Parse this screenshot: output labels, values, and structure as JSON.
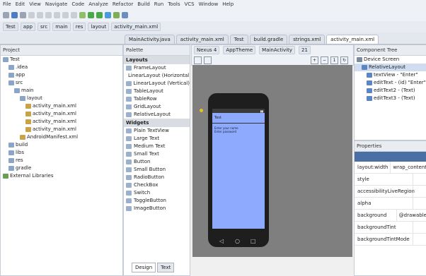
{
  "menubar": {
    "items": [
      "File",
      "Edit",
      "View",
      "Navigate",
      "Code",
      "Analyze",
      "Refactor",
      "Build",
      "Run",
      "Tools",
      "VCS",
      "Window",
      "Help"
    ]
  },
  "navbar": {
    "crumbs": [
      "Test",
      "app",
      "src",
      "main",
      "res",
      "layout",
      "activity_main.xml"
    ]
  },
  "tabs": [
    "MainActivity.java",
    "activity_main.xml",
    "Test",
    "build.gradle",
    "strings.xml",
    "activity_main.xml"
  ],
  "project": {
    "header": "Project",
    "rows": [
      {
        "label": "Test",
        "indent": 0,
        "icon": "folder-icon"
      },
      {
        "label": ".idea",
        "indent": 1,
        "icon": "folder-icon"
      },
      {
        "label": "app",
        "indent": 1,
        "icon": "folder-icon"
      },
      {
        "label": "src",
        "indent": 1,
        "icon": "folder-icon"
      },
      {
        "label": "main",
        "indent": 2,
        "icon": "folder-icon"
      },
      {
        "label": "layout",
        "indent": 3,
        "icon": "folder-icon"
      },
      {
        "label": "activity_main.xml",
        "indent": 4,
        "icon": "file-icon"
      },
      {
        "label": "activity_main.xml",
        "indent": 4,
        "icon": "file-icon"
      },
      {
        "label": "activity_main.xml",
        "indent": 4,
        "icon": "file-icon"
      },
      {
        "label": "activity_main.xml",
        "indent": 4,
        "icon": "file-icon"
      },
      {
        "label": "AndroidManifest.xml",
        "indent": 3,
        "icon": "file-icon"
      },
      {
        "label": "build",
        "indent": 1,
        "icon": "folder-icon"
      },
      {
        "label": "libs",
        "indent": 1,
        "icon": "folder-icon"
      },
      {
        "label": "res",
        "indent": 1,
        "icon": "folder-icon"
      },
      {
        "label": "gradle",
        "indent": 1,
        "icon": "folder-icon"
      },
      {
        "label": "External Libraries",
        "indent": 0,
        "icon": "library-icon"
      }
    ]
  },
  "palette": {
    "header": "Palette",
    "rows": [
      {
        "label": "Layouts",
        "type": "head"
      },
      {
        "label": "FrameLayout",
        "type": "item"
      },
      {
        "label": "LinearLayout (Horizontal)",
        "type": "item"
      },
      {
        "label": "LinearLayout (Vertical)",
        "type": "item"
      },
      {
        "label": "TableLayout",
        "type": "item"
      },
      {
        "label": "TableRow",
        "type": "item"
      },
      {
        "label": "GridLayout",
        "type": "item"
      },
      {
        "label": "RelativeLayout",
        "type": "item"
      },
      {
        "label": "Widgets",
        "type": "head"
      },
      {
        "label": "Plain TextView",
        "type": "item"
      },
      {
        "label": "Large Text",
        "type": "item"
      },
      {
        "label": "Medium Text",
        "type": "item"
      },
      {
        "label": "Small Text",
        "type": "item"
      },
      {
        "label": "Button",
        "type": "item"
      },
      {
        "label": "Small Button",
        "type": "item"
      },
      {
        "label": "RadioButton",
        "type": "item"
      },
      {
        "label": "CheckBox",
        "type": "item"
      },
      {
        "label": "Switch",
        "type": "item"
      },
      {
        "label": "ToggleButton",
        "type": "item"
      },
      {
        "label": "ImageButton",
        "type": "item"
      }
    ]
  },
  "editorbar": {
    "device": "Nexus 4",
    "theme": "AppTheme",
    "activity": "MainActivity",
    "api": "21"
  },
  "phone": {
    "title": "Test",
    "field1": "Enter your name",
    "field2": "Enter password"
  },
  "component_tree": {
    "header": "Component Tree",
    "rows": [
      {
        "label": "Device Screen",
        "indent": 0
      },
      {
        "label": "RelativeLayout",
        "indent": 1
      },
      {
        "label": "textView - \"Enter\"",
        "indent": 2
      },
      {
        "label": "editText - (id) \"Enter\"",
        "indent": 2
      },
      {
        "label": "editText2 - (Text)",
        "indent": 2
      },
      {
        "label": "editText3 - (Text)",
        "indent": 2
      }
    ]
  },
  "properties": {
    "header": "Properties",
    "rows": [
      {
        "k": "layout:width",
        "v": "wrap_content"
      },
      {
        "k": "style",
        "v": ""
      },
      {
        "k": "accessibilityLiveRegion",
        "v": ""
      },
      {
        "k": "alpha",
        "v": ""
      },
      {
        "k": "background",
        "v": "@drawable"
      },
      {
        "k": "backgroundTint",
        "v": ""
      },
      {
        "k": "backgroundTintMode",
        "v": ""
      }
    ]
  },
  "bottom_tabs": [
    "Design",
    "Text"
  ]
}
